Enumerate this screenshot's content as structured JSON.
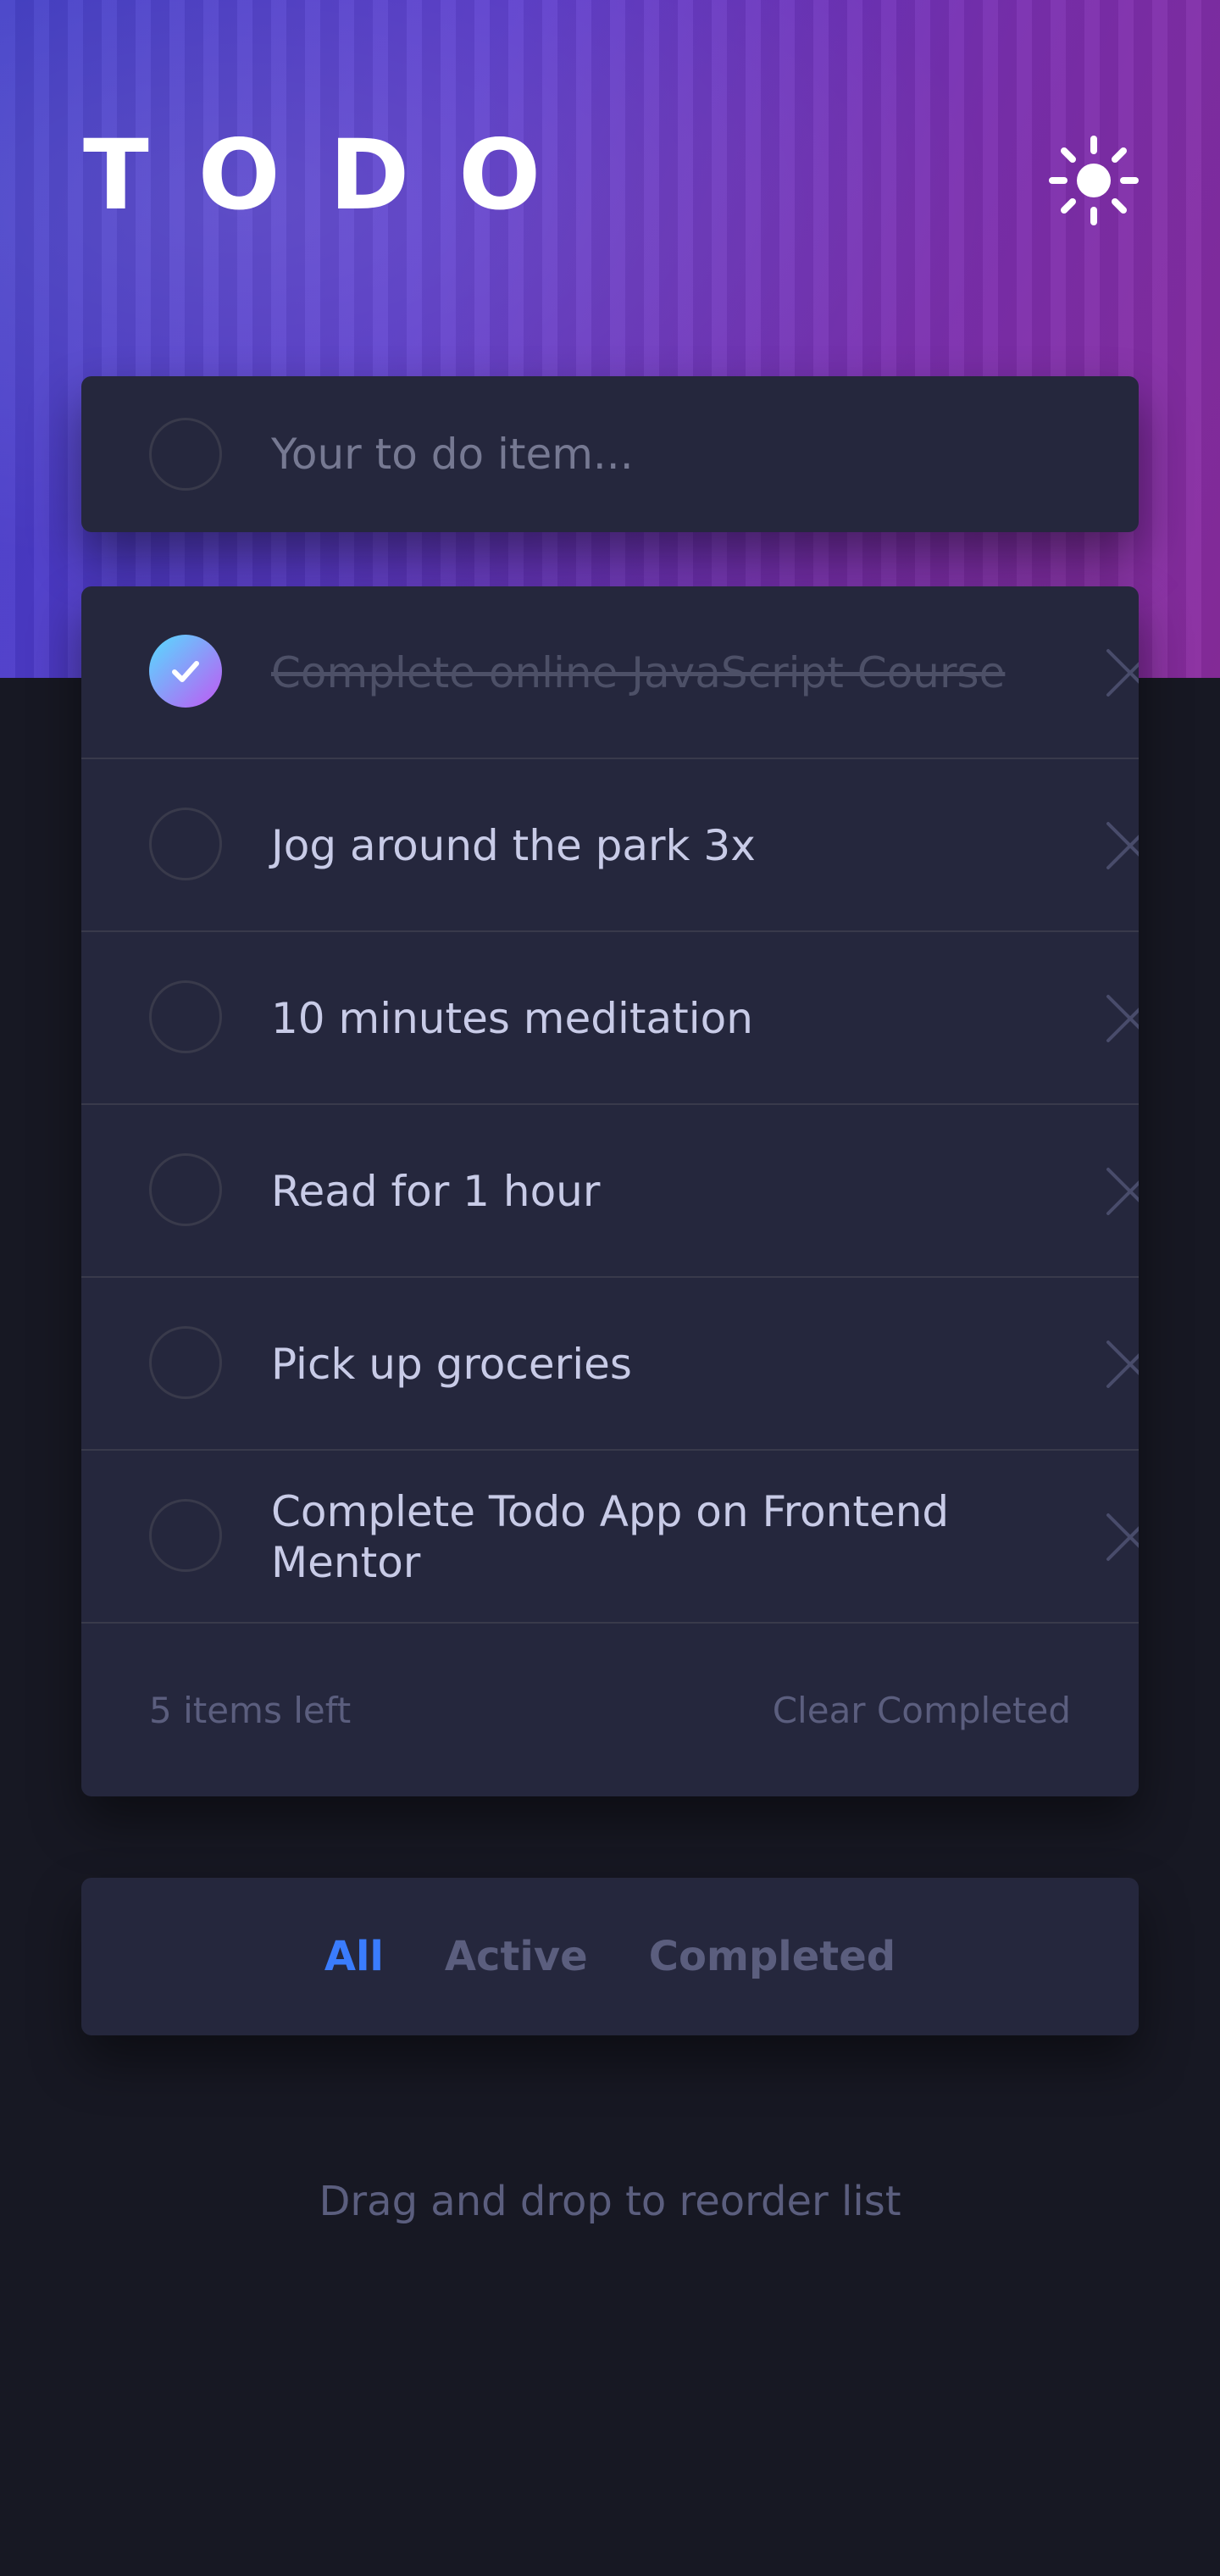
{
  "header": {
    "title": "TODO",
    "theme_icon": "sun-icon"
  },
  "new_todo": {
    "placeholder": "Your to do item...",
    "value": ""
  },
  "todos": [
    {
      "text": "Complete online JavaScript Course",
      "completed": true
    },
    {
      "text": "Jog around the park 3x",
      "completed": false
    },
    {
      "text": "10 minutes meditation",
      "completed": false
    },
    {
      "text": "Read for 1 hour",
      "completed": false
    },
    {
      "text": "Pick up groceries",
      "completed": false
    },
    {
      "text": "Complete Todo App on Frontend Mentor",
      "completed": false
    }
  ],
  "footer": {
    "items_left": "5 items left",
    "clear_completed": "Clear Completed"
  },
  "filters": {
    "all": "All",
    "active": "Active",
    "completed": "Completed",
    "selected": "All"
  },
  "hint": "Drag and drop to reorder list",
  "colors": {
    "background": "#171823",
    "panel": "#25273d",
    "text": "#c8cbe7",
    "muted": "#5b5e7e",
    "accent": "#3a7cfd",
    "check_gradient_start": "#55ddff",
    "check_gradient_end": "#c058f3"
  }
}
